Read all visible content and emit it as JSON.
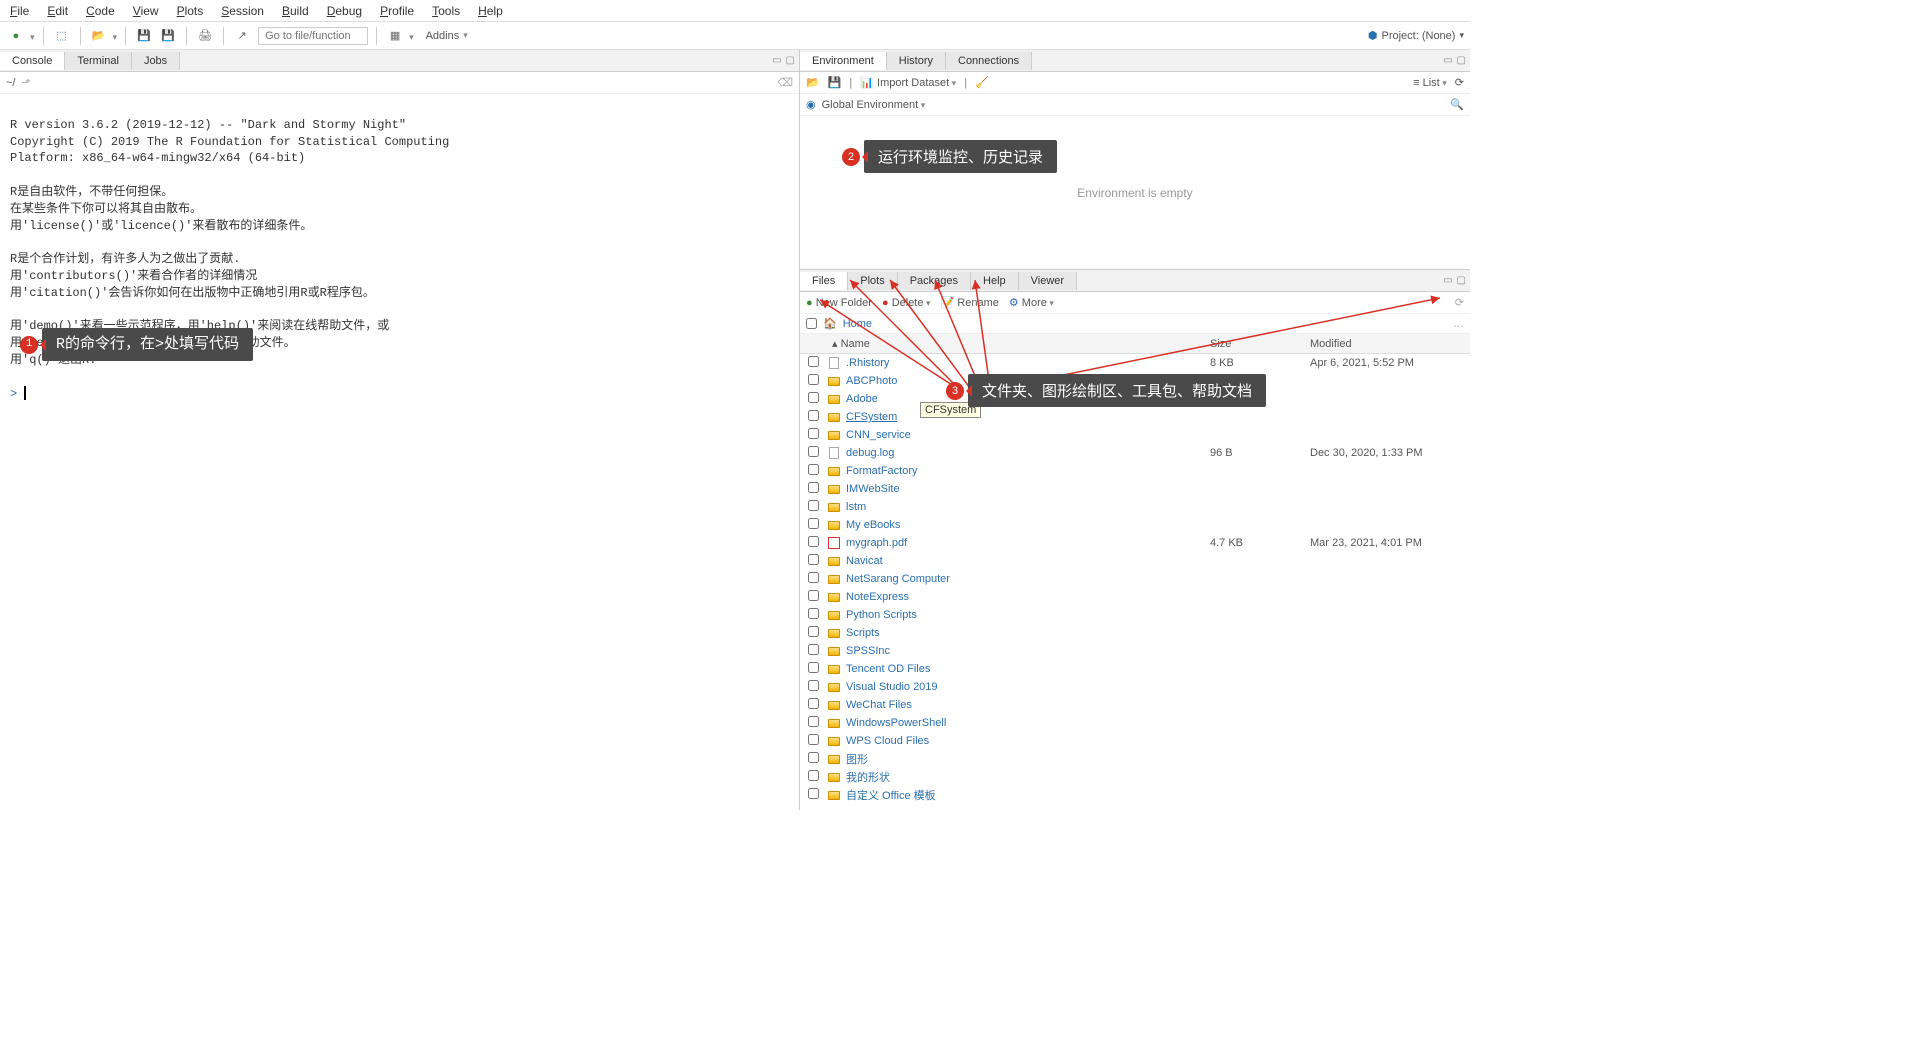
{
  "menu": [
    "File",
    "Edit",
    "Code",
    "View",
    "Plots",
    "Session",
    "Build",
    "Debug",
    "Profile",
    "Tools",
    "Help"
  ],
  "goto_placeholder": "Go to file/function",
  "addins_label": "Addins",
  "project_label": "Project: (None)",
  "left_tabs": {
    "console": "Console",
    "terminal": "Terminal",
    "jobs": "Jobs"
  },
  "console_path": "~/",
  "console_text": "R version 3.6.2 (2019-12-12) -- \"Dark and Stormy Night\"\nCopyright (C) 2019 The R Foundation for Statistical Computing\nPlatform: x86_64-w64-mingw32/x64 (64-bit)\n\nR是自由软件，不带任何担保。\n在某些条件下你可以将其自由散布。\n用'license()'或'licence()'来看散布的详细条件。\n\nR是个合作计划，有许多人为之做出了贡献.\n用'contributors()'来看合作者的详细情况\n用'citation()'会告诉你如何在出版物中正确地引用R或R程序包。\n\n用'demo()'来看一些示范程序，用'help()'来阅读在线帮助文件，或\n用'help.start()'通过HTML浏览器来看帮助文件。\n用'q()'退出R.\n",
  "prompt": ">",
  "env_tabs": {
    "environment": "Environment",
    "history": "History",
    "connections": "Connections"
  },
  "env_import": "Import Dataset",
  "env_list": "List",
  "env_scope": "Global Environment",
  "env_empty": "Environment is empty",
  "files_tabs": {
    "files": "Files",
    "plots": "Plots",
    "packages": "Packages",
    "help": "Help",
    "viewer": "Viewer"
  },
  "files_toolbar": {
    "new": "New Folder",
    "delete": "Delete",
    "rename": "Rename",
    "more": "More"
  },
  "files_home": "Home",
  "files_header": {
    "name": "Name",
    "size": "Size",
    "modified": "Modified"
  },
  "files": [
    {
      "name": ".Rhistory",
      "type": "file",
      "size": "8 KB",
      "modified": "Apr 6, 2021, 5:52 PM"
    },
    {
      "name": "ABCPhoto",
      "type": "folder",
      "size": "",
      "modified": ""
    },
    {
      "name": "Adobe",
      "type": "folder",
      "size": "",
      "modified": ""
    },
    {
      "name": "CFSystem",
      "type": "folder",
      "size": "",
      "modified": "",
      "underline": true
    },
    {
      "name": "CNN_service",
      "type": "folder",
      "size": "",
      "modified": ""
    },
    {
      "name": "debug.log",
      "type": "file",
      "size": "96 B",
      "modified": "Dec 30, 2020, 1:33 PM"
    },
    {
      "name": "FormatFactory",
      "type": "folder",
      "size": "",
      "modified": ""
    },
    {
      "name": "IMWebSite",
      "type": "folder",
      "size": "",
      "modified": ""
    },
    {
      "name": "lstm",
      "type": "folder",
      "size": "",
      "modified": ""
    },
    {
      "name": "My eBooks",
      "type": "folder",
      "size": "",
      "modified": ""
    },
    {
      "name": "mygraph.pdf",
      "type": "pdf",
      "size": "4.7 KB",
      "modified": "Mar 23, 2021, 4:01 PM"
    },
    {
      "name": "Navicat",
      "type": "folder",
      "size": "",
      "modified": ""
    },
    {
      "name": "NetSarang Computer",
      "type": "folder",
      "size": "",
      "modified": ""
    },
    {
      "name": "NoteExpress",
      "type": "folder",
      "size": "",
      "modified": ""
    },
    {
      "name": "Python Scripts",
      "type": "folder",
      "size": "",
      "modified": ""
    },
    {
      "name": "Scripts",
      "type": "folder",
      "size": "",
      "modified": ""
    },
    {
      "name": "SPSSInc",
      "type": "folder",
      "size": "",
      "modified": ""
    },
    {
      "name": "Tencent OD Files",
      "type": "folder",
      "size": "",
      "modified": ""
    },
    {
      "name": "Visual Studio 2019",
      "type": "folder",
      "size": "",
      "modified": ""
    },
    {
      "name": "WeChat Files",
      "type": "folder",
      "size": "",
      "modified": ""
    },
    {
      "name": "WindowsPowerShell",
      "type": "folder",
      "size": "",
      "modified": ""
    },
    {
      "name": "WPS Cloud Files",
      "type": "folder",
      "size": "",
      "modified": ""
    },
    {
      "name": "图形",
      "type": "folder",
      "size": "",
      "modified": ""
    },
    {
      "name": "我的形状",
      "type": "folder",
      "size": "",
      "modified": ""
    },
    {
      "name": "自定义 Office 模板",
      "type": "folder",
      "size": "",
      "modified": ""
    }
  ],
  "tooltip_cfs": "CFSystem",
  "callouts": {
    "c1": "R的命令行，在>处填写代码",
    "c2": "运行环境监控、历史记录",
    "c3": "文件夹、图形绘制区、工具包、帮助文档"
  }
}
